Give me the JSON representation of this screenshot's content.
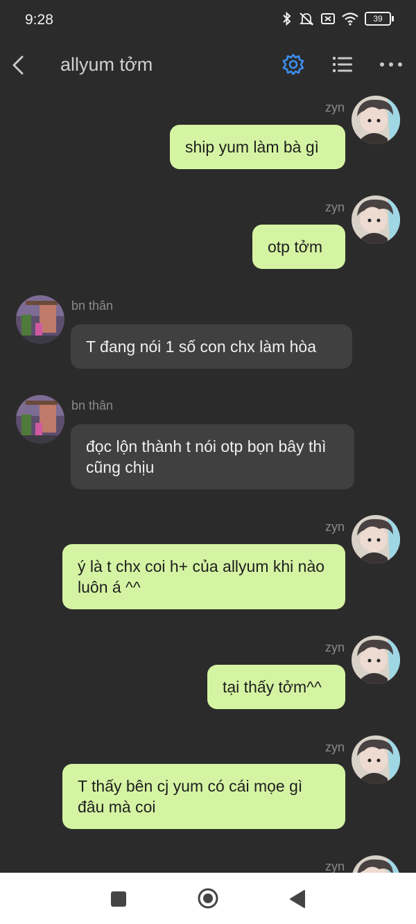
{
  "status": {
    "time": "9:28",
    "battery": "39",
    "icons": [
      "bluetooth-icon",
      "silent-icon",
      "sim-icon",
      "wifi-icon",
      "battery-icon"
    ]
  },
  "header": {
    "title": "allyum tởm",
    "icons": [
      "back-icon",
      "gear-icon",
      "list-icon",
      "more-icon"
    ],
    "accent": "#3d8ff0"
  },
  "colors": {
    "background": "#2b2b2b",
    "bubble_out": "#d5f4a3",
    "bubble_in": "#404040"
  },
  "messages": [
    {
      "sender": "zyn",
      "text": "ship yum làm bà gì",
      "direction": "out"
    },
    {
      "sender": "zyn",
      "text": "otp tởm",
      "direction": "out"
    },
    {
      "sender": "bn thân",
      "text": "T đang nói 1 số con chx làm hòa",
      "direction": "in"
    },
    {
      "sender": "bn thân",
      "text": "đọc lộn thành t nói otp bọn bây thì cũng chịu",
      "direction": "in"
    },
    {
      "sender": "zyn",
      "text": "ý là t chx coi h+ của allyum khi nào luôn á ^^",
      "direction": "out"
    },
    {
      "sender": "zyn",
      "text": "tại thấy tởm^^",
      "direction": "out"
    },
    {
      "sender": "zyn",
      "text": "T thấy bên cj yum có cái mọe gì đâu mà coi",
      "direction": "out"
    },
    {
      "sender": "zyn",
      "text": "",
      "direction": "out"
    }
  ],
  "nav": {
    "icons": [
      "recents-icon",
      "home-icon",
      "back-triangle-icon"
    ]
  }
}
